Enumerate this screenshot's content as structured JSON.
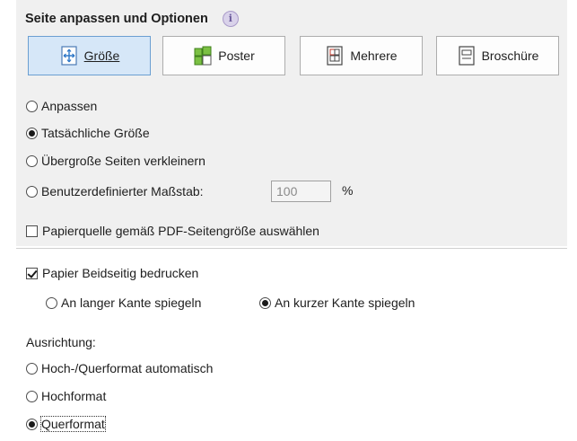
{
  "section": {
    "title": "Seite anpassen und Optionen",
    "info_icon": "info-icon"
  },
  "mode_buttons": [
    {
      "label": "Größe",
      "icon": "size-icon",
      "selected": true
    },
    {
      "label": "Poster",
      "icon": "poster-icon",
      "selected": false
    },
    {
      "label": "Mehrere",
      "icon": "multiple-pages-icon",
      "selected": false
    },
    {
      "label": "Broschüre",
      "icon": "booklet-icon",
      "selected": false
    }
  ],
  "size_options": [
    {
      "label": "Anpassen",
      "checked": false
    },
    {
      "label": "Tatsächliche Größe",
      "checked": true
    },
    {
      "label": "Übergroße Seiten verkleinern",
      "checked": false
    },
    {
      "label": "Benutzerdefinierter Maßstab:",
      "checked": false
    }
  ],
  "custom_scale": {
    "value": "100",
    "unit": "%"
  },
  "paper_source": {
    "label": "Papierquelle gemäß PDF-Seitengröße auswählen",
    "checked": false
  },
  "duplex": {
    "label": "Papier Beidseitig bedrucken",
    "checked": true,
    "options": [
      {
        "label": "An langer Kante spiegeln",
        "checked": false
      },
      {
        "label": "An kurzer Kante spiegeln",
        "checked": true
      }
    ]
  },
  "orientation": {
    "label": "Ausrichtung:",
    "options": [
      {
        "label": "Hoch-/Querformat automatisch",
        "checked": false
      },
      {
        "label": "Hochformat",
        "checked": false
      },
      {
        "label": "Querformat",
        "checked": true
      }
    ]
  }
}
